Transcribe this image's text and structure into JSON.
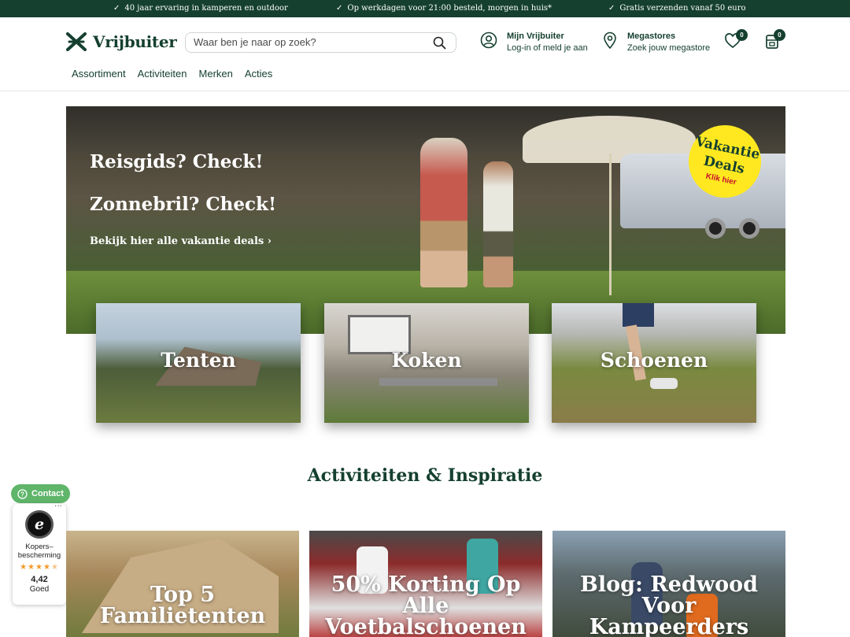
{
  "usp": [
    {
      "text": "40 jaar ervaring in kamperen en outdoor"
    },
    {
      "text": "Op werkdagen voor 21:00 besteld, morgen in huis*"
    },
    {
      "text": "Gratis verzenden vanaf 50 euro"
    }
  ],
  "header": {
    "logo_text": "Vrijbuiter",
    "search_placeholder": "Waar ben je naar op zoek?",
    "account": {
      "title": "Mijn Vrijbuiter",
      "subtitle": "Log-in of meld je aan"
    },
    "stores": {
      "title": "Megastores",
      "subtitle": "Zoek jouw megastore"
    },
    "wishlist_count": "0",
    "cart_count": "0"
  },
  "nav": [
    "Assortiment",
    "Activiteiten",
    "Merken",
    "Acties"
  ],
  "hero": {
    "title": "Reisgids? Check! Zonnebril? Check!",
    "link": "Bekijk hier alle vakantie deals ›",
    "badge": {
      "line1": "Vakantie",
      "line2": "Deals",
      "cta": "Klik hier"
    }
  },
  "categories": [
    "Tenten",
    "Koken",
    "Schoenen"
  ],
  "section_title": "Activiteiten & Inspiratie",
  "widgets": {
    "contact": "Contact",
    "trust": {
      "label": "Kopers– bescherming",
      "score": "4,42",
      "level": "Goed",
      "rating": 4.42
    }
  },
  "cards": [
    "Top 5 Familietenten",
    "50% Korting Op Alle Voetbalschoenen",
    "Blog: Redwood Voor Kampeerders"
  ],
  "colors": {
    "brand": "#15402f",
    "accent": "#ffe81f",
    "contact": "#5fb56a"
  }
}
